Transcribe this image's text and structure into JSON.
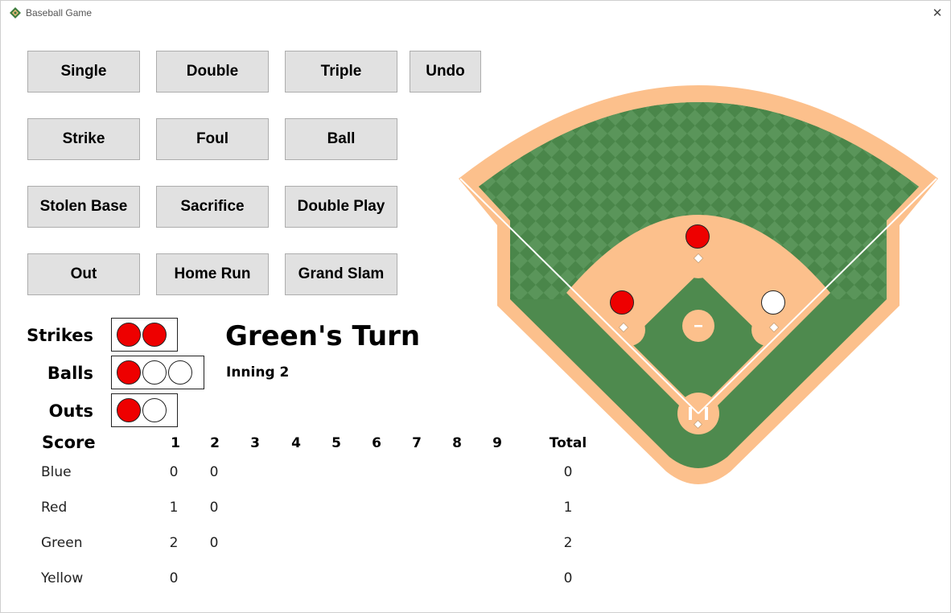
{
  "window": {
    "title": "Baseball Game",
    "close_glyph": "✕"
  },
  "buttons": {
    "single": "Single",
    "double": "Double",
    "triple": "Triple",
    "undo": "Undo",
    "strike": "Strike",
    "foul": "Foul",
    "ball": "Ball",
    "stolen_base": "Stolen Base",
    "sacrifice": "Sacrifice",
    "double_play": "Double Play",
    "out": "Out",
    "home_run": "Home Run",
    "grand_slam": "Grand Slam"
  },
  "count": {
    "strikes_label": "Strikes",
    "strikes": {
      "filled": 2,
      "total": 2
    },
    "balls_label": "Balls",
    "balls": {
      "filled": 1,
      "total": 3
    },
    "outs_label": "Outs",
    "outs": {
      "filled": 1,
      "total": 2
    }
  },
  "status": {
    "turn": "Green's Turn",
    "inning": "Inning 2"
  },
  "scoreboard": {
    "title": "Score",
    "innings": [
      "1",
      "2",
      "3",
      "4",
      "5",
      "6",
      "7",
      "8",
      "9"
    ],
    "total_label": "Total",
    "teams": [
      {
        "name": "Blue",
        "scores": [
          "0",
          "0",
          "",
          "",
          "",
          "",
          "",
          "",
          ""
        ],
        "total": "0"
      },
      {
        "name": "Red",
        "scores": [
          "1",
          "0",
          "",
          "",
          "",
          "",
          "",
          "",
          ""
        ],
        "total": "1"
      },
      {
        "name": "Green",
        "scores": [
          "2",
          "0",
          "",
          "",
          "",
          "",
          "",
          "",
          ""
        ],
        "total": "2"
      },
      {
        "name": "Yellow",
        "scores": [
          "0",
          "",
          "",
          "",
          "",
          "",
          "",
          "",
          ""
        ],
        "total": "0"
      }
    ]
  },
  "field": {
    "runners": {
      "first": false,
      "second": true,
      "third": true
    },
    "colors": {
      "grass": "#4e8a4e",
      "dirt": "#fcc08c",
      "runner_on": "#ee0000",
      "runner_off": "#ffffff"
    }
  }
}
